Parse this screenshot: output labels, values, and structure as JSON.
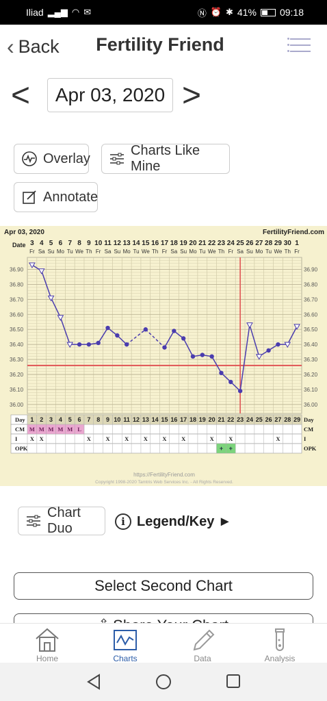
{
  "status_bar": {
    "carrier": "Iliad",
    "battery": "41%",
    "time": "09:18"
  },
  "nav": {
    "back_label": "Back",
    "title": "Fertility Friend"
  },
  "date_selector": {
    "date": "Apr 03, 2020"
  },
  "buttons": {
    "overlay": "Overlay",
    "charts_like_mine": "Charts Like Mine",
    "annotate": "Annotate",
    "chart_duo": "Chart Duo",
    "legend_key": "Legend/Key ►",
    "select_second_chart": "Select Second Chart",
    "share_chart_partial": "Share Your Chart"
  },
  "tabs": [
    {
      "label": "Home",
      "icon": "home-icon"
    },
    {
      "label": "Charts",
      "icon": "charts-icon"
    },
    {
      "label": "Data",
      "icon": "pencil-icon"
    },
    {
      "label": "Analysis",
      "icon": "test-tube-icon"
    }
  ],
  "chart_data": {
    "type": "line",
    "chart_date": "Apr 03, 2020",
    "brand": "FertilityFriend.com",
    "date_row_label": "Date",
    "dates": [
      "3",
      "4",
      "5",
      "6",
      "7",
      "8",
      "9",
      "10",
      "11",
      "12",
      "13",
      "14",
      "15",
      "16",
      "17",
      "18",
      "19",
      "20",
      "21",
      "22",
      "23",
      "24",
      "25",
      "26",
      "27",
      "28",
      "29",
      "30",
      "1"
    ],
    "weekdays": [
      "Fr",
      "Sa",
      "Su",
      "Mo",
      "Tu",
      "We",
      "Th",
      "Fr",
      "Sa",
      "Su",
      "Mo",
      "Tu",
      "We",
      "Th",
      "Fr",
      "Sa",
      "Su",
      "Mo",
      "Tu",
      "We",
      "Th",
      "Fr",
      "Sa",
      "Su",
      "Mo",
      "Tu",
      "We",
      "Th",
      "Fr"
    ],
    "day_row_label": "Day",
    "days": [
      1,
      2,
      3,
      4,
      5,
      6,
      7,
      8,
      9,
      10,
      11,
      12,
      13,
      14,
      15,
      16,
      17,
      18,
      19,
      20,
      21,
      22,
      23,
      24,
      25,
      26,
      27,
      28,
      29
    ],
    "y_ticks": [
      "36.90",
      "36.80",
      "36.70",
      "36.60",
      "36.50",
      "36.40",
      "36.30",
      "36.20",
      "36.10",
      "36.00"
    ],
    "ylim": [
      35.94,
      36.98
    ],
    "temperatures": [
      36.93,
      36.89,
      36.71,
      36.58,
      36.4,
      36.4,
      36.4,
      36.41,
      36.51,
      36.46,
      36.4,
      null,
      36.5,
      null,
      36.38,
      36.49,
      36.44,
      36.32,
      36.33,
      36.32,
      36.21,
      36.15,
      36.09,
      36.53,
      36.32,
      36.36,
      36.4,
      36.4,
      36.52
    ],
    "open_markers_days": [
      1,
      2,
      3,
      4,
      5,
      24,
      25,
      28,
      29
    ],
    "dashed_segments": [
      [
        11,
        13
      ],
      [
        13,
        15
      ]
    ],
    "coverline": 36.26,
    "ovulation_day": 23,
    "cm_label": "CM",
    "cm_values": [
      "M",
      "M",
      "M",
      "M",
      "M",
      "L"
    ],
    "i_label": "I",
    "i_days": [
      1,
      2,
      7,
      9,
      11,
      13,
      15,
      17,
      20,
      22,
      27
    ],
    "opk_label": "OPK",
    "opk_positive_days": [
      21,
      22
    ],
    "footer_url": "https://FertilityFriend.com",
    "footer_copyright": "Copyright 1998-2020 Tamtris Web Services Inc. - All Rights Reserved."
  }
}
